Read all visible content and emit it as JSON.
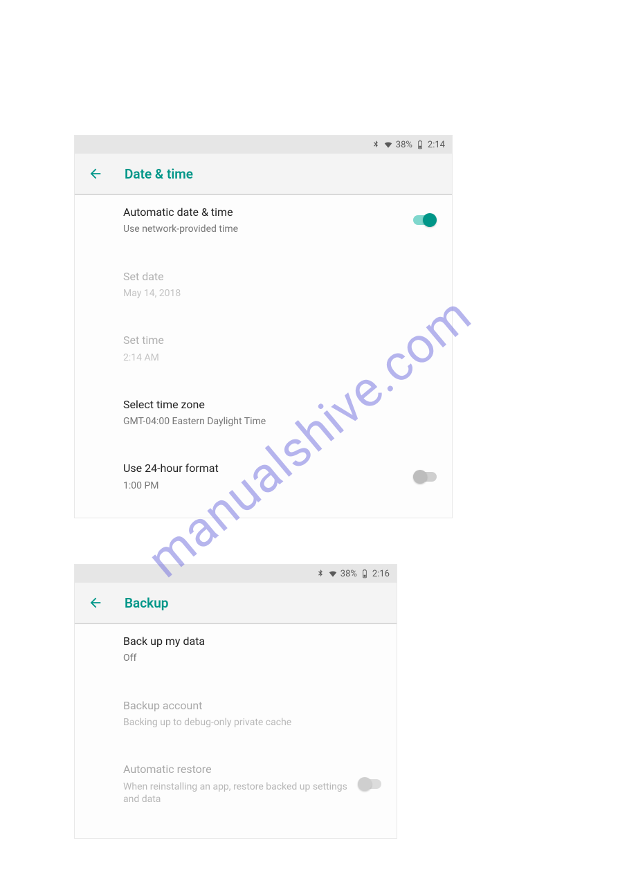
{
  "watermark": "manualshive.com",
  "screen1": {
    "statusbar": {
      "battery": "38%",
      "time": "2:14"
    },
    "title": "Date & time",
    "rows": {
      "auto": {
        "primary": "Automatic date & time",
        "secondary": "Use network-provided time"
      },
      "setdate": {
        "primary": "Set date",
        "secondary": "May 14, 2018"
      },
      "settime": {
        "primary": "Set time",
        "secondary": "2:14 AM"
      },
      "tz": {
        "primary": "Select time zone",
        "secondary": "GMT-04:00 Eastern Daylight Time"
      },
      "fmt": {
        "primary": "Use 24-hour format",
        "secondary": "1:00 PM"
      }
    }
  },
  "screen2": {
    "statusbar": {
      "battery": "38%",
      "time": "2:16"
    },
    "title": "Backup",
    "rows": {
      "backupdata": {
        "primary": "Back up my data",
        "secondary": "Off"
      },
      "account": {
        "primary": "Backup account",
        "secondary": "Backing up to debug-only private cache"
      },
      "restore": {
        "primary": "Automatic restore",
        "secondary": "When reinstalling an app, restore backed up settings and data"
      }
    }
  }
}
